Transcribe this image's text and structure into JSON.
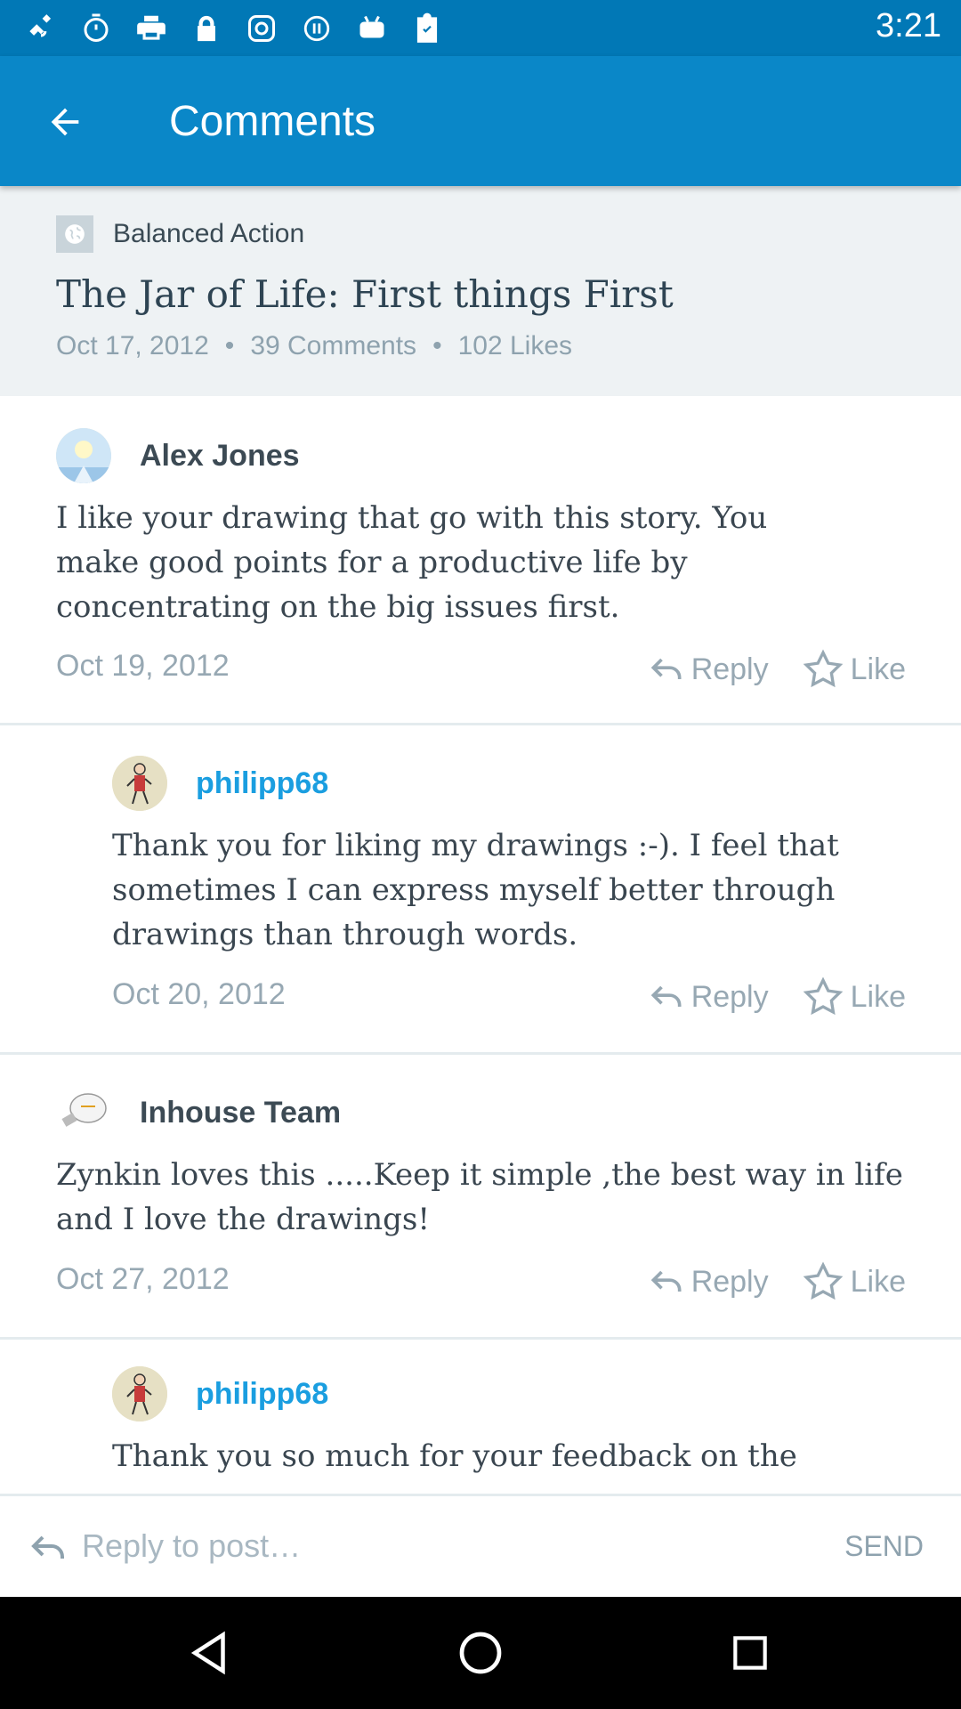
{
  "status_bar": {
    "time": "3:21",
    "icons": [
      "satellite-icon",
      "stopwatch-icon",
      "printer-icon",
      "lock-icon",
      "instagram-icon",
      "info-icon",
      "robot-icon",
      "clipboard-check-icon"
    ]
  },
  "app_bar": {
    "title": "Comments",
    "back_icon": "arrow-back-icon"
  },
  "post": {
    "site_name": "Balanced Action",
    "title": "The Jar of Life: First things First",
    "date": "Oct 17, 2012",
    "separator": "•",
    "comments_count": "39 Comments",
    "likes_count": "102 Likes"
  },
  "comments": [
    {
      "author": "Alex Jones",
      "text": "I like your drawing that go with this story. You make good points for a productive life by concentrating on the big issues first.",
      "date": "Oct 19, 2012",
      "reply_label": "Reply",
      "like_label": "Like"
    },
    {
      "author": "philipp68",
      "text": "Thank you for liking my drawings :-). I feel that sometimes I can express myself better through drawings than through words.",
      "date": "Oct 20, 2012",
      "reply_label": "Reply",
      "like_label": "Like"
    },
    {
      "author": "Inhouse Team",
      "text": "Zynkin loves this .....Keep it simple ,the best way in life and I love the drawings!",
      "date": "Oct 27, 2012",
      "reply_label": "Reply",
      "like_label": "Like"
    },
    {
      "author": "philipp68",
      "text": "Thank you so much for your feedback on the"
    }
  ],
  "reply_bar": {
    "placeholder": "Reply to post…",
    "send_label": "SEND"
  },
  "colors": {
    "status_bar": "#0178b6",
    "app_bar": "#0a87c8",
    "link": "#1a9ee0",
    "muted": "#97a8b3",
    "header_bg": "#eef2f4"
  }
}
